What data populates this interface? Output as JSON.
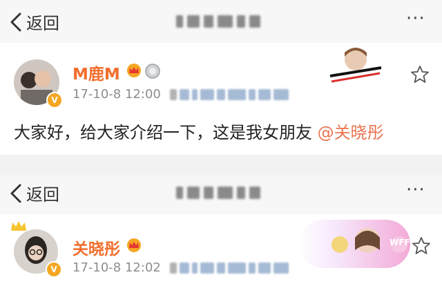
{
  "top1": {
    "back_label": "返回",
    "more": "···"
  },
  "post1": {
    "username": "M鹿M",
    "timestamp": "17-10-8 12:00",
    "text": "大家好，给大家介绍一下，这是我女朋友 ",
    "mention": "@关晓彤"
  },
  "top2": {
    "back_label": "返回",
    "more": "···"
  },
  "post2": {
    "username": "关晓彤",
    "timestamp": "17-10-8 12:02",
    "promo_label": "WFF"
  },
  "colors": {
    "username": "#f26e2c",
    "mention": "#eb7350",
    "verified_badge": "#f5a623",
    "bar_bg": "#f7f7f7"
  }
}
